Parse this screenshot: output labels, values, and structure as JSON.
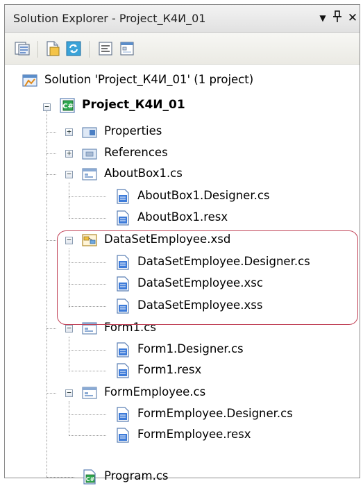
{
  "window": {
    "title": "Solution Explorer - Project_К4И_01",
    "dropdown_glyph": "▼",
    "pin_glyph": "ª",
    "close_glyph": "✕"
  },
  "toolbar": {
    "buttons": [
      {
        "name": "properties-icon"
      },
      {
        "name": "show-all-files-icon"
      },
      {
        "name": "refresh-icon"
      },
      {
        "name": "view-code-icon"
      },
      {
        "name": "view-designer-icon"
      }
    ]
  },
  "tree": {
    "solution": {
      "label": "Solution 'Project_К4И_01' (1 project)"
    },
    "project": {
      "label": "Project_К4И_01"
    },
    "items": [
      {
        "label": "Properties"
      },
      {
        "label": "References"
      },
      {
        "label": "AboutBox1.cs"
      },
      {
        "label": "AboutBox1.Designer.cs"
      },
      {
        "label": "AboutBox1.resx"
      },
      {
        "label": "DataSetEmployee.xsd"
      },
      {
        "label": "DataSetEmployee.Designer.cs"
      },
      {
        "label": "DataSetEmployee.xsc"
      },
      {
        "label": "DataSetEmployee.xss"
      },
      {
        "label": "Form1.cs"
      },
      {
        "label": "Form1.Designer.cs"
      },
      {
        "label": "Form1.resx"
      },
      {
        "label": "FormEmployee.cs"
      },
      {
        "label": "FormEmployee.Designer.cs"
      },
      {
        "label": "FormEmployee.resx"
      },
      {
        "label": "Program.cs"
      }
    ]
  },
  "colors": {
    "highlight_border": "#c04055",
    "folder_blue": "#5b8dc9",
    "file_blue": "#3d7bd9"
  }
}
